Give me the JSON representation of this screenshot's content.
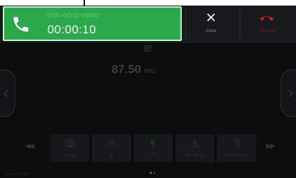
{
  "call": {
    "number": "000-0000-0000",
    "timer": "00:00:10"
  },
  "actions": {
    "close_label": "Close",
    "end_label": "End Call"
  },
  "radio": {
    "frequency": "87.50",
    "unit": "MHz"
  },
  "presets": [
    {
      "icon": "folder-icon",
      "label": "Preset"
    },
    {
      "icon": "signal-icon",
      "label": "TA"
    },
    {
      "icon": "tune-icon",
      "label": "PTY"
    },
    {
      "icon": "memory-icon",
      "label": "Auto.Memory"
    },
    {
      "icon": "info-icon",
      "label": "PTY Search"
    }
  ],
  "status": "Source: RADIO",
  "colors": {
    "call_green": "#2aa84a",
    "end_red": "#c02020",
    "screen_bg": "#0b0d0d"
  }
}
